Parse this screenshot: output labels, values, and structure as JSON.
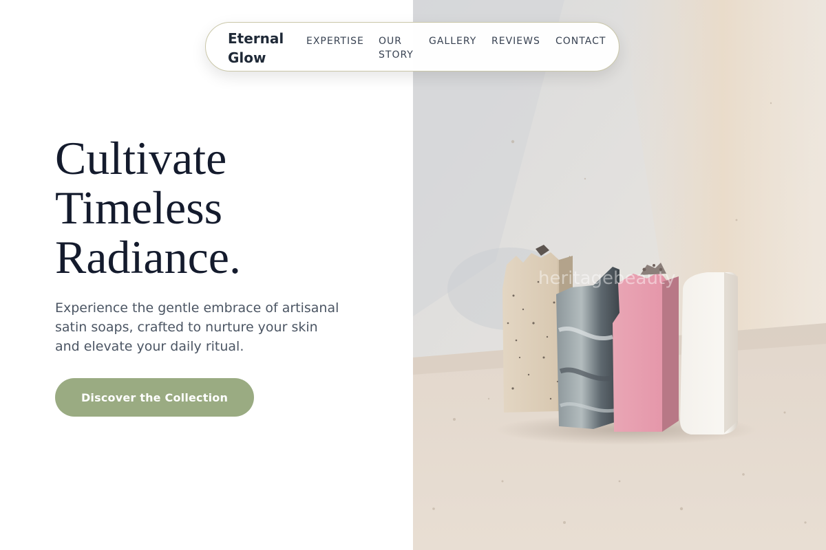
{
  "nav": {
    "brand_line1": "Eternal",
    "brand_line2": "Glow",
    "items": [
      {
        "label": "EXPERTISE"
      },
      {
        "label_line1": "OUR",
        "label_line2": "STORY"
      },
      {
        "label": "GALLERY"
      },
      {
        "label": "REVIEWS"
      },
      {
        "label": "CONTACT"
      }
    ]
  },
  "hero": {
    "title_line1": "Cultivate",
    "title_line2": "Timeless",
    "title_line3": "Radiance.",
    "description_line1": "Experience the gentle embrace of artisanal",
    "description_line2": "satin soaps, crafted to nurture your skin",
    "description_line3": "and elevate your daily ritual.",
    "cta_label": "Discover the Collection"
  },
  "photo": {
    "watermark": "heritagebeauty"
  },
  "colors": {
    "accent": "#9aab82",
    "title": "#141b2d",
    "body_text": "#4b5563",
    "nav_border": "#c9c6a8"
  }
}
